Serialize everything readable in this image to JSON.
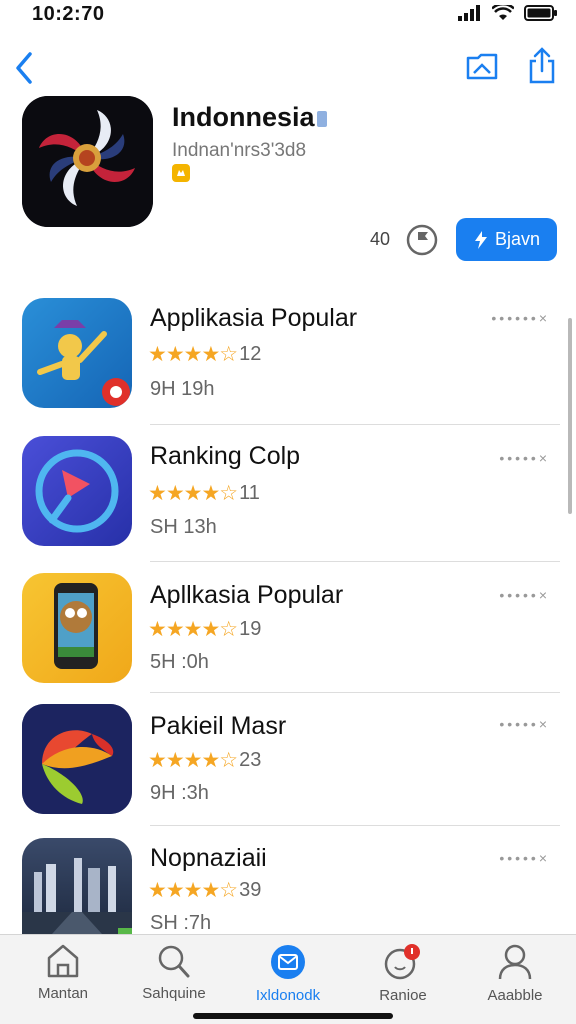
{
  "status": {
    "time": "10:2:70"
  },
  "nav": {
    "back": "chevron-left-icon",
    "actions": [
      "folder-image-icon",
      "share-icon"
    ]
  },
  "hero": {
    "title": "Indonnesia",
    "subtitle": "Indnan'nrs3'3d8",
    "count": "40",
    "action_label": "Bjavn"
  },
  "apps": [
    {
      "title": "Applikasia Popular",
      "rating": "12",
      "meta": "9H 19h",
      "stars": 4.5
    },
    {
      "title": "Ranking Colp",
      "rating": "11",
      "meta": "SH 13h",
      "stars": 4.5
    },
    {
      "title": "Apllkasia Popular",
      "rating": "19",
      "meta": "5H :0h",
      "stars": 4.5
    },
    {
      "title": "Pakieil Masr",
      "rating": "23",
      "meta": "9H :3h",
      "stars": 4.5
    },
    {
      "title": "Nopnaziaii",
      "rating": "39",
      "meta": "SH :7h",
      "stars": 4.5
    }
  ],
  "tabs": [
    {
      "label": "Mantan",
      "icon": "home-icon"
    },
    {
      "label": "Sahquine",
      "icon": "search-icon"
    },
    {
      "label": "Ixldonodk",
      "icon": "compass-mail-icon",
      "active": true
    },
    {
      "label": "Ranioe",
      "icon": "bell-icon"
    },
    {
      "label": "Aaabble",
      "icon": "person-icon"
    }
  ],
  "colors": {
    "accent": "#1a7ff0",
    "star": "#f5a623"
  }
}
